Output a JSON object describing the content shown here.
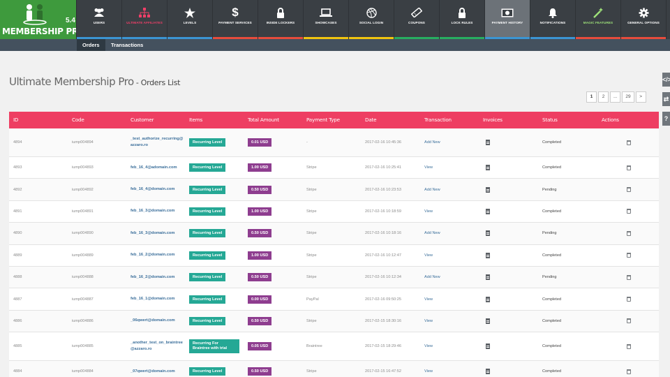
{
  "brand": {
    "name": "MEMBERSHIP PRO",
    "version": "5.4"
  },
  "nav": [
    {
      "label": "USERS",
      "icon": "users-icon"
    },
    {
      "label": "ULTIMATE AFFILIATES",
      "icon": "affiliate-network-icon"
    },
    {
      "label": "LEVELS",
      "icon": "star-icon"
    },
    {
      "label": "PAYMENT SERVICES",
      "icon": "dollar-icon"
    },
    {
      "label": "INSIDE LOCKERS",
      "icon": "lock-icon"
    },
    {
      "label": "SHOWCASES",
      "icon": "laptop-icon"
    },
    {
      "label": "SOCIAL LOGIN",
      "icon": "dribbble-icon"
    },
    {
      "label": "COUPONS",
      "icon": "ticket-icon"
    },
    {
      "label": "LOCK RULES",
      "icon": "lock-icon"
    },
    {
      "label": "PAYMENT HISTORY",
      "icon": "money-icon"
    },
    {
      "label": "NOTIFICATIONS",
      "icon": "bell-icon"
    },
    {
      "label": "MAGIC FEATURES",
      "icon": "magic-wand-icon"
    },
    {
      "label": "GENERAL OPTIONS",
      "icon": "gear-icon"
    }
  ],
  "nav_bar_colors": [
    "#3b95d3",
    "#3b95d3",
    "#3b95d3",
    "#e74c3c",
    "#e74c3c",
    "#f1c40f",
    "#f1c40f",
    "#27ae60",
    "#27ae60",
    "#3b95d3",
    "#3b95d3",
    "#e74c3c",
    "#e74c3c"
  ],
  "subtabs": [
    "Orders",
    "Transactions"
  ],
  "title": {
    "main": "Ultimate Membership Pro",
    "sub": " - Orders List"
  },
  "pagination": [
    "1",
    "2",
    "...",
    "29",
    ">"
  ],
  "side_widgets": [
    "</>",
    "⇄",
    "?"
  ],
  "columns": [
    "ID",
    "Code",
    "Customer",
    "Items",
    "Total Amount",
    "Payment Type",
    "Date",
    "Transaction",
    "Invoices",
    "Status",
    "Actions"
  ],
  "rows": [
    {
      "id": "4894",
      "code": "iump004894",
      "customer": "_test_authorize_recurring@azzaro.ro",
      "item": "Recurring Level",
      "amount": "0.01 USD",
      "payment": "-",
      "date": "2017-02-16 10:45:36",
      "transaction": "Add New",
      "status": "Completed"
    },
    {
      "id": "4893",
      "code": "iump004893",
      "customer": "feb_16_4@adomain.com",
      "item": "Recurring Level",
      "amount": "1.00 USD",
      "payment": "Stripe",
      "date": "2017-02-16 10:25:41",
      "transaction": "View",
      "status": "Completed"
    },
    {
      "id": "4892",
      "code": "iump004892",
      "customer": "feb_16_4@domain.com",
      "item": "Recurring Level",
      "amount": "0.50 USD",
      "payment": "Stripe",
      "date": "2017-02-16 10:23:53",
      "transaction": "Add New",
      "status": "Pending"
    },
    {
      "id": "4891",
      "code": "iump004891",
      "customer": "feb_16_3@domain.com",
      "item": "Recurring Level",
      "amount": "1.00 USD",
      "payment": "Stripe",
      "date": "2017-02-16 10:18:59",
      "transaction": "View",
      "status": "Completed"
    },
    {
      "id": "4890",
      "code": "iump004890",
      "customer": "feb_16_3@domain.com",
      "item": "Recurring Level",
      "amount": "0.50 USD",
      "payment": "Stripe",
      "date": "2017-02-16 10:18:16",
      "transaction": "Add New",
      "status": "Pending"
    },
    {
      "id": "4889",
      "code": "iump004889",
      "customer": "feb_16_2@domain.com",
      "item": "Recurring Level",
      "amount": "1.00 USD",
      "payment": "Stripe",
      "date": "2017-02-16 10:12:47",
      "transaction": "View",
      "status": "Completed"
    },
    {
      "id": "4888",
      "code": "iump004888",
      "customer": "feb_16_2@domain.com",
      "item": "Recurring Level",
      "amount": "0.50 USD",
      "payment": "Stripe",
      "date": "2017-02-16 10:12:34",
      "transaction": "Add New",
      "status": "Pending"
    },
    {
      "id": "4887",
      "code": "iump004887",
      "customer": "feb_16_1@domain.com",
      "item": "Recurring Level",
      "amount": "0.00 USD",
      "payment": "PayPal",
      "date": "2017-02-16 09:50:25",
      "transaction": "View",
      "status": "Completed"
    },
    {
      "id": "4886",
      "code": "iump004886",
      "customer": "_06qwert@domain.com",
      "item": "Recurring Level",
      "amount": "0.50 USD",
      "payment": "Stripe",
      "date": "2017-02-15 18:30:16",
      "transaction": "View",
      "status": "Completed"
    },
    {
      "id": "4885",
      "code": "iump004885",
      "customer": "_another_test_on_braintree@azzaro.ro",
      "item": "Recurring For Braintree with trial",
      "amount": "0.05 USD",
      "payment": "Braintree",
      "date": "2017-02-15 18:29:46",
      "transaction": "View",
      "status": "Completed"
    },
    {
      "id": "4884",
      "code": "iump004884",
      "customer": "_07qwert@domain.com",
      "item": "Recurring Level",
      "amount": "0.50 USD",
      "payment": "Stripe",
      "date": "2017-02-15 16:47:52",
      "transaction": "View",
      "status": "Completed"
    }
  ]
}
